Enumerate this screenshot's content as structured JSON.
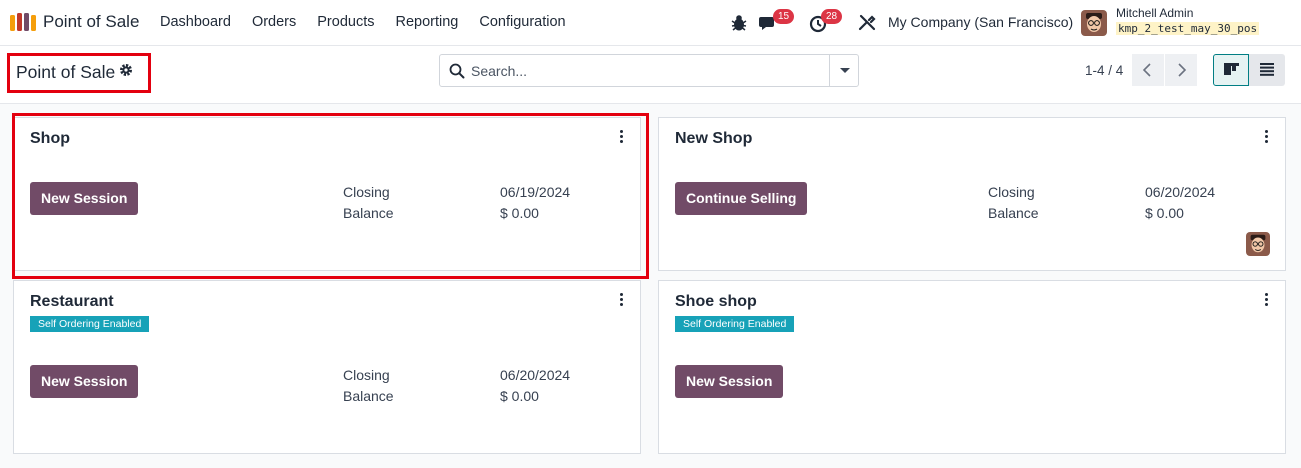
{
  "app": {
    "name": "Point of Sale"
  },
  "menu": [
    "Dashboard",
    "Orders",
    "Products",
    "Reporting",
    "Configuration"
  ],
  "systray": {
    "messages_count": "15",
    "activities_count": "28",
    "company": "My Company (San Francisco)",
    "user_name": "Mitchell Admin",
    "database": "kmp_2_test_may_30_pos"
  },
  "control": {
    "title": "Point of Sale",
    "search_placeholder": "Search...",
    "pager": "1-4 / 4"
  },
  "cards": [
    {
      "name": "Shop",
      "button": "New Session",
      "closing_label": "Closing",
      "closing_date": "06/19/2024",
      "balance_label": "Balance",
      "balance": "$ 0.00"
    },
    {
      "name": "New Shop",
      "button": "Continue Selling",
      "closing_label": "Closing",
      "closing_date": "06/20/2024",
      "balance_label": "Balance",
      "balance": "$ 0.00"
    },
    {
      "name": "Restaurant",
      "badge": "Self Ordering Enabled",
      "button": "New Session",
      "closing_label": "Closing",
      "closing_date": "06/20/2024",
      "balance_label": "Balance",
      "balance": "$ 0.00"
    },
    {
      "name": "Shoe shop",
      "badge": "Self Ordering Enabled",
      "button": "New Session"
    }
  ],
  "colors": {
    "primary_button": "#714b67",
    "badge_info": "#17a2b8",
    "notification": "#dc3545",
    "highlight": "#e3000f",
    "active_view": "#017e84"
  },
  "icons": [
    "pos-app-icon",
    "bug-icon",
    "chat-icon",
    "clock-icon",
    "tools-icon",
    "gear-icon",
    "search-icon",
    "chevron-left-icon",
    "chevron-right-icon",
    "kanban-view-icon",
    "list-view-icon",
    "kebab-menu-icon"
  ]
}
